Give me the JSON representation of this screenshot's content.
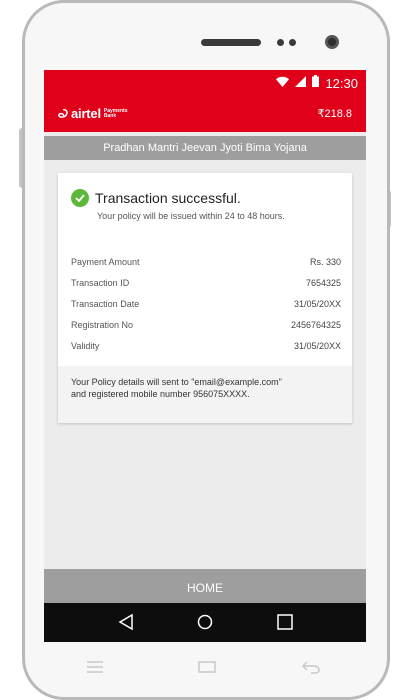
{
  "status_bar": {
    "time": "12:30"
  },
  "header": {
    "brand": "airtel",
    "brand_sub_line1": "Payments",
    "brand_sub_line2": "Bank",
    "balance": "₹218.8"
  },
  "page_title": "Pradhan Mantri Jeevan Jyoti Bima Yojana",
  "result": {
    "title": "Transaction successful.",
    "subtitle": "Your policy will be issued within 24 to 48 hours."
  },
  "details": [
    {
      "label": "Payment Amount",
      "value": "Rs. 330"
    },
    {
      "label": "Transaction ID",
      "value": "7654325"
    },
    {
      "label": "Transaction Date",
      "value": "31/05/20XX"
    },
    {
      "label": "Registration No",
      "value": "2456764325"
    },
    {
      "label": "Validity",
      "value": "31/05/20XX"
    }
  ],
  "policy_note": {
    "line1": "Your Policy details will sent to \"email@example.com\"",
    "line2": "and registered mobile number 956075XXXX."
  },
  "home_button": "HOME",
  "colors": {
    "brand_red": "#e1001a",
    "success_green": "#5cb83a",
    "bar_grey": "#9e9e9e"
  },
  "icons": {
    "status": [
      "wifi-icon",
      "signal-icon",
      "battery-icon"
    ],
    "nav": [
      "back-icon",
      "home-icon",
      "recents-icon"
    ],
    "hardware": [
      "menu-icon",
      "window-icon",
      "return-icon"
    ],
    "result": "check-circle-icon"
  }
}
